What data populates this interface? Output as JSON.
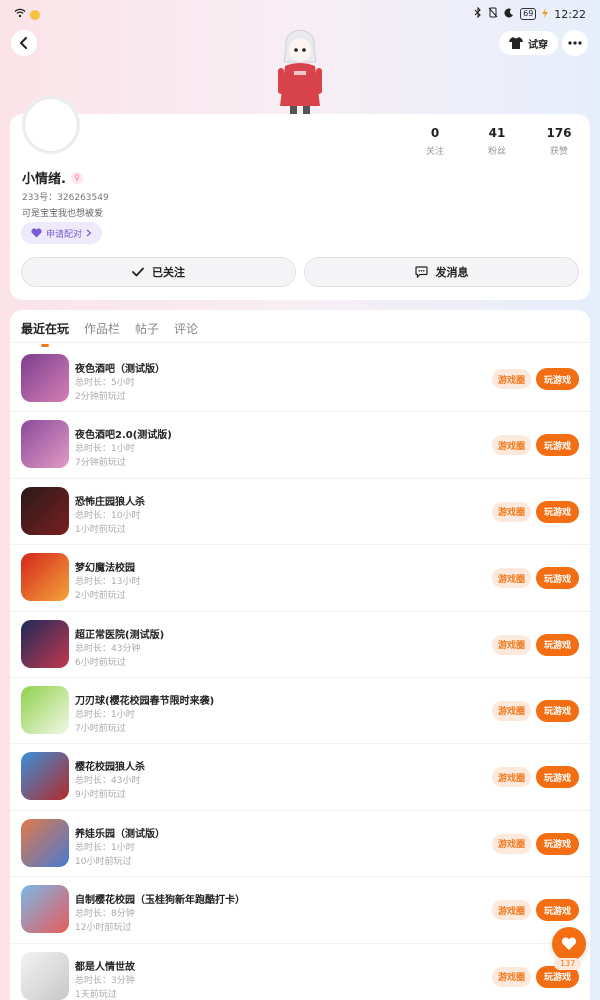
{
  "status_bar": {
    "time": "12:22",
    "battery": "69"
  },
  "nav": {
    "try_on_label": "试穿"
  },
  "profile": {
    "nickname": "小情绪.",
    "uid": "233号：326263549",
    "bio": "可是宝宝我也想被爱",
    "pair_label": "申请配对",
    "stats": [
      {
        "value": "0",
        "label": "关注"
      },
      {
        "value": "41",
        "label": "粉丝"
      },
      {
        "value": "176",
        "label": "获赞"
      }
    ],
    "follow_label": "已关注",
    "message_label": "发消息"
  },
  "tabs": [
    "最近在玩",
    "作品栏",
    "帖子",
    "评论"
  ],
  "active_tab": 0,
  "game_buttons": {
    "circle": "游戏圈",
    "play": "玩游戏"
  },
  "games": [
    {
      "title": "夜色酒吧（测试版）",
      "duration": "总时长：5小时",
      "last_played": "2分钟前玩过",
      "thumb_colors": [
        "#7b3e8f",
        "#d57fb4"
      ]
    },
    {
      "title": "夜色酒吧2.0(测试版)",
      "duration": "总时长：1小时",
      "last_played": "7分钟前玩过",
      "thumb_colors": [
        "#8a4a9a",
        "#e29ac4"
      ]
    },
    {
      "title": "恐怖庄园狼人杀",
      "duration": "总时长：10小时",
      "last_played": "1小时前玩过",
      "thumb_colors": [
        "#2a1a1a",
        "#7a1f1f"
      ]
    },
    {
      "title": "梦幻魔法校园",
      "duration": "总时长：13小时",
      "last_played": "2小时前玩过",
      "thumb_colors": [
        "#d4261c",
        "#f4a43a"
      ]
    },
    {
      "title": "超正常医院(测试版)",
      "duration": "总时长：43分钟",
      "last_played": "6小时前玩过",
      "thumb_colors": [
        "#1c2a5a",
        "#c4384e"
      ]
    },
    {
      "title": "刀刃球(樱花校园春节限时来袭)",
      "duration": "总时长：1小时",
      "last_played": "7小时前玩过",
      "thumb_colors": [
        "#8fd14a",
        "#f3f7e8"
      ]
    },
    {
      "title": "樱花校园狼人杀",
      "duration": "总时长：43小时",
      "last_played": "9小时前玩过",
      "thumb_colors": [
        "#3a8fd8",
        "#b22a2a"
      ]
    },
    {
      "title": "养娃乐园（测试版）",
      "duration": "总时长：1小时",
      "last_played": "10小时前玩过",
      "thumb_colors": [
        "#e07a4a",
        "#4a7ad0"
      ]
    },
    {
      "title": "自制樱花校园（玉桂狗新年跑酷打卡）",
      "duration": "总时长：8分钟",
      "last_played": "12小时前玩过",
      "thumb_colors": [
        "#7ab8e8",
        "#e85a5a"
      ]
    },
    {
      "title": "都是人情世故",
      "duration": "总时长：3分钟",
      "last_played": "1天前玩过",
      "thumb_colors": [
        "#f2f2f2",
        "#c8c8c8"
      ]
    }
  ],
  "like": {
    "count": "137"
  },
  "colors": {
    "accent": "#f36d12",
    "accent_light": "#fde9dc",
    "pair_purple": "#7a5bd4"
  }
}
